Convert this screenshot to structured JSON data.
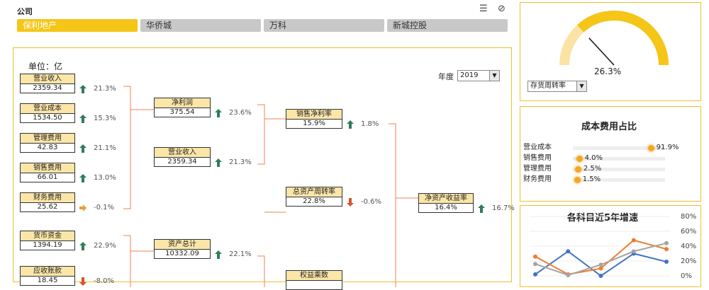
{
  "header": {
    "company_label": "公司",
    "tabs": [
      {
        "label": "保利地产",
        "active": true
      },
      {
        "label": "华侨城",
        "active": false
      },
      {
        "label": "万科",
        "active": false
      },
      {
        "label": "新城控股",
        "active": false
      }
    ]
  },
  "main": {
    "unit_label": "单位：亿",
    "year_label": "年度",
    "year_value": "2019",
    "column1": [
      {
        "title": "营业收入",
        "value": "2359.34",
        "pct": "21.3%",
        "trend": "up"
      },
      {
        "title": "营业成本",
        "value": "1534.50",
        "pct": "15.3%",
        "trend": "up"
      },
      {
        "title": "管理费用",
        "value": "42.83",
        "pct": "21.1%",
        "trend": "up"
      },
      {
        "title": "销售费用",
        "value": "66.01",
        "pct": "13.0%",
        "trend": "up"
      },
      {
        "title": "财务费用",
        "value": "25.62",
        "pct": "-0.1%",
        "trend": "flat"
      },
      {
        "title": "货币资金",
        "value": "1394.19",
        "pct": "22.9%",
        "trend": "up"
      },
      {
        "title": "应收账款",
        "value": "18.45",
        "pct": "-8.0%",
        "trend": "down"
      }
    ],
    "column2": [
      {
        "title": "净利润",
        "value": "375.54",
        "pct": "23.6%",
        "trend": "up"
      },
      {
        "title": "营业收入",
        "value": "2359.34",
        "pct": "21.3%",
        "trend": "up"
      },
      {
        "title": "资产总计",
        "value": "10332.09",
        "pct": "22.1%",
        "trend": "up"
      }
    ],
    "column3": [
      {
        "title": "销售净利率",
        "value": "15.9%",
        "pct": "1.8%",
        "trend": "up"
      },
      {
        "title": "总资产周转率",
        "value": "22.8%",
        "pct": "-0.6%",
        "trend": "down"
      },
      {
        "title": "权益乘数",
        "value": "",
        "pct": "",
        "trend": "none"
      }
    ],
    "column4": [
      {
        "title": "净资产收益率",
        "value": "16.4%",
        "pct": "16.7%",
        "trend": "up"
      }
    ]
  },
  "gauge": {
    "value": "26.3%",
    "fraction": 0.263,
    "dropdown_value": "存货周转率"
  },
  "cost_ratio": {
    "title": "成本费用占比",
    "items": [
      {
        "label": "营业成本",
        "value": "91.9%",
        "fraction": 0.919
      },
      {
        "label": "销售费用",
        "value": "4.0%",
        "fraction": 0.04
      },
      {
        "label": "管理费用",
        "value": "2.5%",
        "fraction": 0.025
      },
      {
        "label": "财务费用",
        "value": "1.5%",
        "fraction": 0.015
      }
    ]
  },
  "chart_data": {
    "type": "line",
    "title": "各科目近5年增速",
    "ylim": [
      0,
      0.8
    ],
    "yticks": [
      "80%",
      "60%",
      "40%",
      "20%",
      "0%"
    ],
    "x": [
      1,
      2,
      3,
      4,
      5
    ],
    "series": [
      {
        "color": "#4472c4",
        "values": [
          0.02,
          0.33,
          0.0,
          0.3,
          0.19
        ]
      },
      {
        "color": "#ed7d31",
        "values": [
          0.26,
          0.02,
          0.1,
          0.48,
          0.36
        ]
      },
      {
        "color": "#a5a5a5",
        "values": [
          0.16,
          0.01,
          0.15,
          0.33,
          0.44
        ]
      }
    ]
  },
  "colors": {
    "accent": "#f5c518",
    "panel_border": "#f0c030",
    "up": "#2e7d5b",
    "down": "#d9532b",
    "flat": "#e0a030"
  }
}
